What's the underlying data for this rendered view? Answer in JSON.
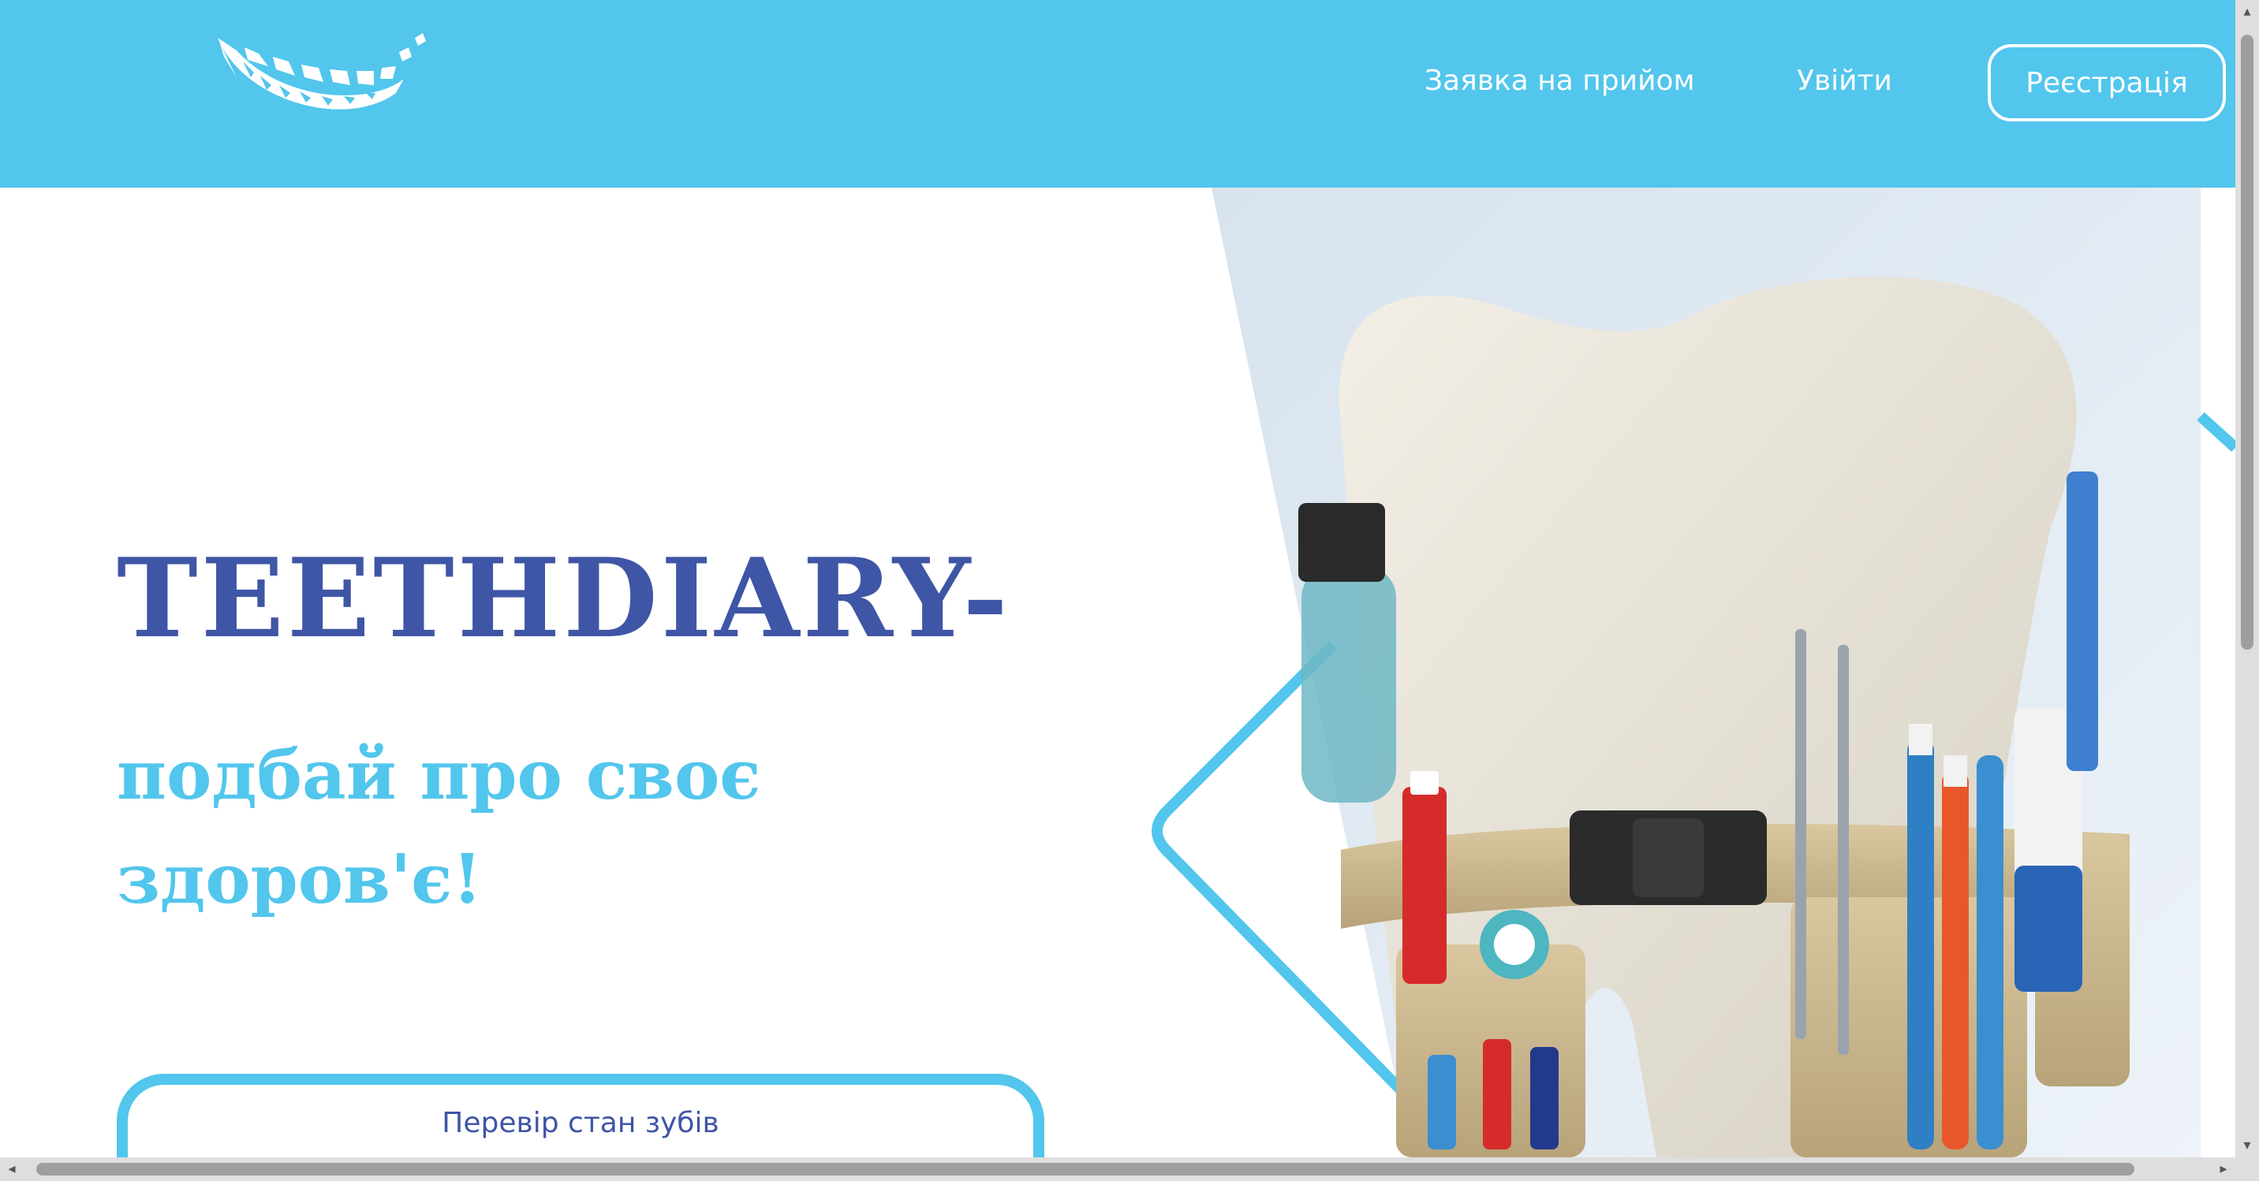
{
  "header": {
    "nav": {
      "appointment": "Заявка на прийом",
      "login": "Увійти",
      "register": "Реєстрація"
    }
  },
  "hero": {
    "title": "TEETHDIARY-",
    "subtitle": "подбай про своє здоров'є!",
    "cta": "Перевір стан зубів"
  },
  "colors": {
    "header_bg": "#52c6ec",
    "title": "#3f55a6",
    "accent": "#52c6ec"
  },
  "icons": {
    "logo": "smile-teeth-logo",
    "illustration": "tooth-with-hygiene-tool-belt"
  }
}
